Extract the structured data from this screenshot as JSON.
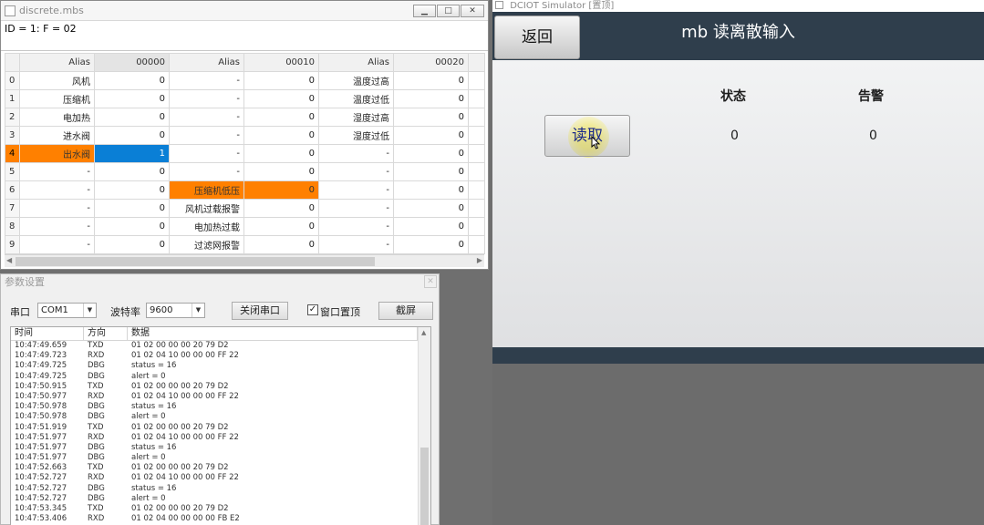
{
  "mbs_window": {
    "title": "discrete.mbs",
    "id_line": "ID = 1: F = 02",
    "headers": [
      "Alias",
      "00000",
      "Alias",
      "00010",
      "Alias",
      "00020"
    ],
    "rows": [
      {
        "n": "0",
        "a1": "风机",
        "v1": "0",
        "a2": "-",
        "v2": "0",
        "a3": "温度过高",
        "v3": "0"
      },
      {
        "n": "1",
        "a1": "压缩机",
        "v1": "0",
        "a2": "-",
        "v2": "0",
        "a3": "温度过低",
        "v3": "0"
      },
      {
        "n": "2",
        "a1": "电加热",
        "v1": "0",
        "a2": "-",
        "v2": "0",
        "a3": "湿度过高",
        "v3": "0"
      },
      {
        "n": "3",
        "a1": "进水阀",
        "v1": "0",
        "a2": "-",
        "v2": "0",
        "a3": "湿度过低",
        "v3": "0"
      },
      {
        "n": "4",
        "a1": "出水阀",
        "v1": "1",
        "a2": "-",
        "v2": "0",
        "a3": "-",
        "v3": "0"
      },
      {
        "n": "5",
        "a1": "-",
        "v1": "0",
        "a2": "-",
        "v2": "0",
        "a3": "-",
        "v3": "0"
      },
      {
        "n": "6",
        "a1": "-",
        "v1": "0",
        "a2": "压缩机低压",
        "v2": "0",
        "a3": "-",
        "v3": "0"
      },
      {
        "n": "7",
        "a1": "-",
        "v1": "0",
        "a2": "风机过载报警",
        "v2": "0",
        "a3": "-",
        "v3": "0"
      },
      {
        "n": "8",
        "a1": "-",
        "v1": "0",
        "a2": "电加热过载",
        "v2": "0",
        "a3": "-",
        "v3": "0"
      },
      {
        "n": "9",
        "a1": "-",
        "v1": "0",
        "a2": "过滤网报警",
        "v2": "0",
        "a3": "-",
        "v3": "0"
      }
    ]
  },
  "param_window": {
    "title": "参数设置",
    "port_label": "串口",
    "port_value": "COM1",
    "baud_label": "波特率",
    "baud_value": "9600",
    "close_port_label": "关闭串口",
    "topmost_label": "窗口置顶",
    "topmost_checked": "✓",
    "screenshot_label": "截屏",
    "log_headers": [
      "时间",
      "方向",
      "数据"
    ],
    "log": [
      [
        "10:47:49.659",
        "TXD",
        "01 02 00 00 00 20 79 D2"
      ],
      [
        "10:47:49.723",
        "RXD",
        "01 02 04 10 00 00 00 FF 22"
      ],
      [
        "10:47:49.725",
        "DBG",
        "status  = 16"
      ],
      [
        "10:47:49.725",
        "DBG",
        "alert = 0"
      ],
      [
        "10:47:50.915",
        "TXD",
        "01 02 00 00 00 20 79 D2"
      ],
      [
        "10:47:50.977",
        "RXD",
        "01 02 04 10 00 00 00 FF 22"
      ],
      [
        "10:47:50.978",
        "DBG",
        "status  = 16"
      ],
      [
        "10:47:50.978",
        "DBG",
        "alert = 0"
      ],
      [
        "10:47:51.919",
        "TXD",
        "01 02 00 00 00 20 79 D2"
      ],
      [
        "10:47:51.977",
        "RXD",
        "01 02 04 10 00 00 00 FF 22"
      ],
      [
        "10:47:51.977",
        "DBG",
        "status  = 16"
      ],
      [
        "10:47:51.977",
        "DBG",
        "alert = 0"
      ],
      [
        "10:47:52.663",
        "TXD",
        "01 02 00 00 00 20 79 D2"
      ],
      [
        "10:47:52.727",
        "RXD",
        "01 02 04 10 00 00 00 FF 22"
      ],
      [
        "10:47:52.727",
        "DBG",
        "status  = 16"
      ],
      [
        "10:47:52.727",
        "DBG",
        "alert = 0"
      ],
      [
        "10:47:53.345",
        "TXD",
        "01 02 00 00 00 20 79 D2"
      ],
      [
        "10:47:53.406",
        "RXD",
        "01 02 04 00 00 00 00 FB E2"
      ]
    ]
  },
  "simulator": {
    "window_title": "DCIOT Simulator [置顶]",
    "back_label": "返回",
    "heading": "mb 读离散输入",
    "read_label": "读取",
    "status_label": "状态",
    "status_value": "0",
    "alert_label": "告警",
    "alert_value": "0"
  },
  "colors": {
    "highlight": "#ff8000",
    "selection": "#0a7fd6",
    "header_bar": "#2f3e4c"
  }
}
